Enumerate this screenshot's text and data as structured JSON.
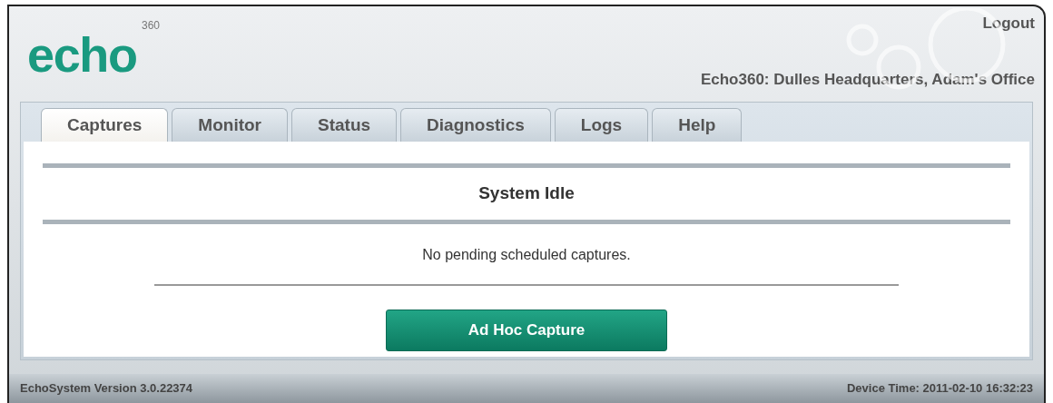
{
  "header": {
    "logo": "echo",
    "logo_superscript": "360",
    "logout": "Logout",
    "location": "Echo360: Dulles Headquarters, Adam's Office"
  },
  "tabs": [
    {
      "label": "Captures",
      "selected": true
    },
    {
      "label": "Monitor",
      "selected": false
    },
    {
      "label": "Status",
      "selected": false
    },
    {
      "label": "Diagnostics",
      "selected": false
    },
    {
      "label": "Logs",
      "selected": false
    },
    {
      "label": "Help",
      "selected": false
    }
  ],
  "content": {
    "heading": "System Idle",
    "message": "No pending scheduled captures.",
    "button": "Ad Hoc Capture"
  },
  "status_bar": {
    "version": "EchoSystem Version 3.0.22374",
    "device_time": "Device Time: 2011-02-10 16:32:23"
  }
}
